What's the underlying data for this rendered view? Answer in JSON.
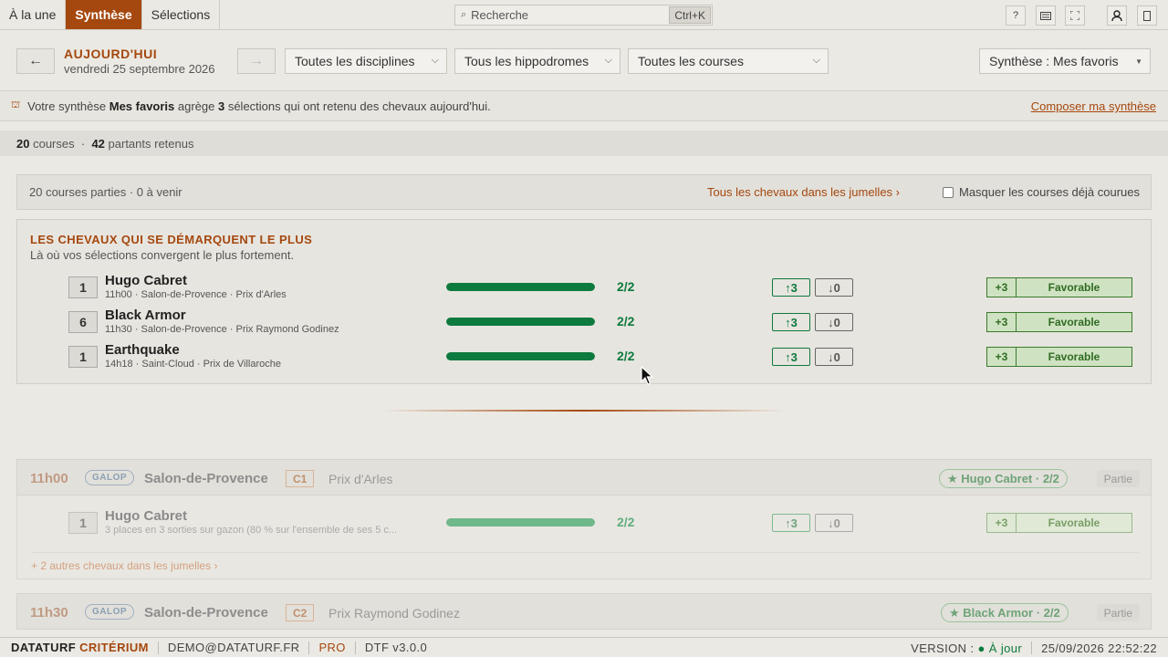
{
  "topbar": {
    "tabs": [
      {
        "label": "À la une"
      },
      {
        "label": "Synthèse"
      },
      {
        "label": "Sélections"
      }
    ],
    "search": {
      "placeholder": "Recherche",
      "shortcut": "Ctrl+K"
    },
    "icons": [
      "help-icon",
      "keyboard-icon",
      "fullscreen-icon",
      "user-icon",
      "panel-icon"
    ]
  },
  "nav": {
    "prev": "←",
    "next": "→",
    "title": "AUJOURD'HUI",
    "date": "vendredi 25 septembre 2026",
    "filters": {
      "discipline": "Toutes les disciplines",
      "hippodrome": "Tous les hippodromes",
      "course": "Toutes les courses",
      "synthese": "Synthèse : Mes favoris"
    }
  },
  "info": {
    "prefix": "Votre synthèse ",
    "name": "Mes favoris",
    "mid": " agrège ",
    "count": "3",
    "suffix": " sélections qui ont retenu des chevaux aujourd'hui.",
    "link": "Composer ma synthèse"
  },
  "summary": {
    "courses": "20",
    "courses_label": "courses",
    "sep": "·",
    "partants": "42",
    "partants_label": "partants retenus"
  },
  "status": {
    "text": "20 courses parties · 0 à venir",
    "link": "Tous les chevaux dans les jumelles ›",
    "hide_label": "Masquer les courses déjà courues"
  },
  "standout": {
    "title": "LES CHEVAUX QUI SE DÉMARQUENT LE PLUS",
    "subtitle": "Là où vos sélections convergent le plus fortement.",
    "rows": [
      {
        "num": "1",
        "name": "Hugo Cabret",
        "meta": "11h00 · Salon-de-Provence · Prix d'Arles",
        "ratio": 1.0,
        "score": "2/2",
        "up": "3",
        "down": "0",
        "plus": "+3",
        "verdict": "Favorable"
      },
      {
        "num": "6",
        "name": "Black Armor",
        "meta": "11h30 · Salon-de-Provence · Prix Raymond Godinez",
        "ratio": 1.0,
        "score": "2/2",
        "up": "3",
        "down": "0",
        "plus": "+3",
        "verdict": "Favorable"
      },
      {
        "num": "1",
        "name": "Earthquake",
        "meta": "14h18 · Saint-Cloud · Prix de Villaroche",
        "ratio": 1.0,
        "score": "2/2",
        "up": "3",
        "down": "0",
        "plus": "+3",
        "verdict": "Favorable"
      }
    ]
  },
  "races": [
    {
      "time": "11h00",
      "discipline": "GALOP",
      "hippodrome": "Salon-de-Provence",
      "code": "C1",
      "prix": "Prix d'Arles",
      "badge": "★ Hugo Cabret · 2/2",
      "state": "Partie",
      "horse": {
        "num": "1",
        "name": "Hugo Cabret",
        "meta": "3 places en 3 sorties sur gazon (80 % sur l'ensemble de ses 5 c...",
        "ratio": 1.0,
        "score": "2/2",
        "up": "3",
        "down": "0",
        "plus": "+3",
        "verdict": "Favorable"
      },
      "more": "+ 2 autres chevaux dans les jumelles ›"
    },
    {
      "time": "11h30",
      "discipline": "GALOP",
      "hippodrome": "Salon-de-Provence",
      "code": "C2",
      "prix": "Prix Raymond Godinez",
      "badge": "★ Black Armor · 2/2",
      "state": "Partie"
    }
  ],
  "footer": {
    "brand1": "DATATURF",
    "brand2": "CRITÉRIUM",
    "email": "DEMO@DATATURF.FR",
    "plan": "PRO",
    "version_code": "DTF v3.0.0",
    "version_label": "VERSION :",
    "version_status": "● À jour",
    "datetime": "25/09/2026 22:52:22"
  },
  "colors": {
    "accent": "#a5480f",
    "positive": "#0d7a3e",
    "favorable_bg": "#cfe3c2"
  }
}
